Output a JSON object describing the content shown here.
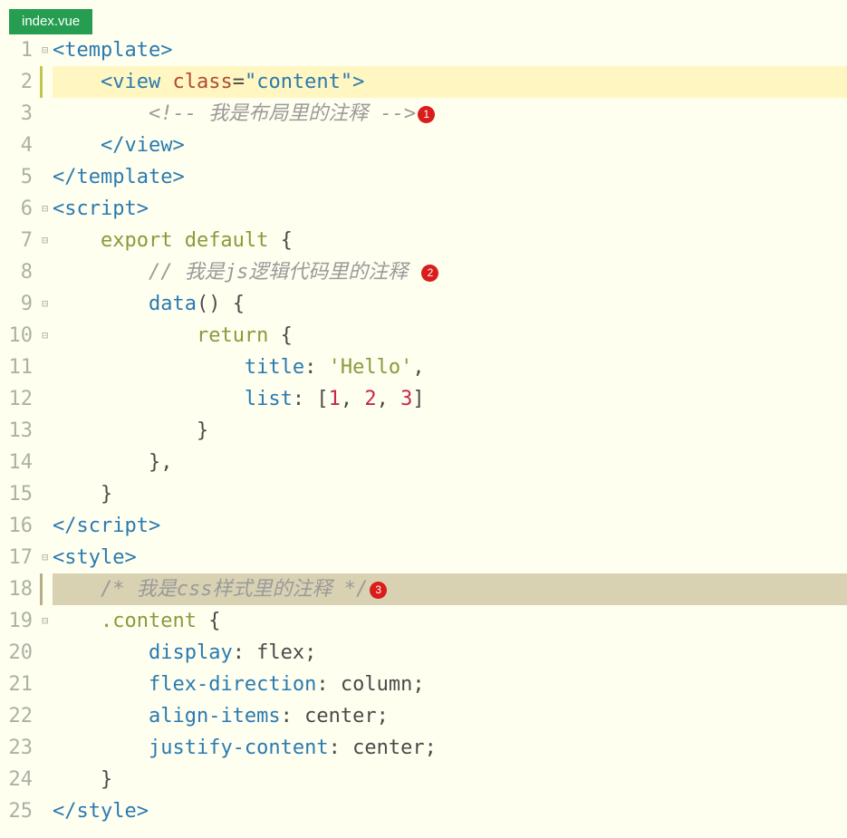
{
  "tab": {
    "name": "index.vue"
  },
  "badges": {
    "b1": "1",
    "b2": "2",
    "b3": "3"
  },
  "lines": {
    "l1a": "<template>",
    "l2_tag_open": "<view ",
    "l2_attr": "class",
    "l2_eq": "=",
    "l2_val": "\"content\"",
    "l2_tag_close": ">",
    "l3_comm": "<!-- 我是布局里的注释 -->",
    "l4": "</view>",
    "l5": "</template>",
    "l6": "<script>",
    "l7_kw": "export default",
    "l7_brace": " {",
    "l8_comm": "// 我是js逻辑代码里的注释 ",
    "l9_fn": "data",
    "l9_rest": "() {",
    "l10_kw": "return",
    "l10_brace": " {",
    "l11_key": "title",
    "l11_colon": ": ",
    "l11_val": "'Hello'",
    "l11_comma": ",",
    "l12_key": "list",
    "l12_colon": ": [",
    "l12_n1": "1",
    "l12_c1": ", ",
    "l12_n2": "2",
    "l12_c2": ", ",
    "l12_n3": "3",
    "l12_close": "]",
    "l13": "}",
    "l14": "},",
    "l15": "}",
    "l16": "</script>",
    "l17": "<style>",
    "l18_comm": "/* 我是css样式里的注释 */",
    "l19_sel": ".content ",
    "l19_brace": "{",
    "l20_p": "display",
    "l20_v": ": flex;",
    "l21_p": "flex-direction",
    "l21_v": ": column;",
    "l22_p": "align-items",
    "l22_v": ": center;",
    "l23_p": "justify-content",
    "l23_v": ": center;",
    "l24": "}",
    "l25": "</style>"
  },
  "gutter": [
    "1",
    "2",
    "3",
    "4",
    "5",
    "6",
    "7",
    "8",
    "9",
    "10",
    "11",
    "12",
    "13",
    "14",
    "15",
    "16",
    "17",
    "18",
    "19",
    "20",
    "21",
    "22",
    "23",
    "24",
    "25"
  ],
  "fold": [
    "⊟",
    "",
    "",
    "",
    "",
    "⊟",
    "⊟",
    "",
    "⊟",
    "⊟",
    "",
    "",
    "",
    "",
    "",
    "",
    "⊟",
    "",
    "⊟",
    "",
    "",
    "",
    "",
    "",
    ""
  ]
}
